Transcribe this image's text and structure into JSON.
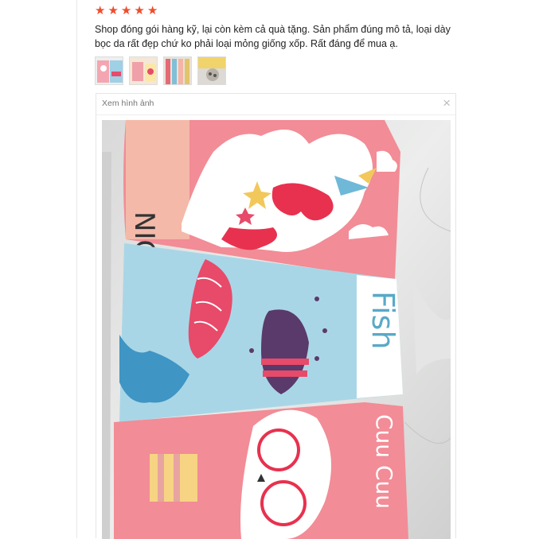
{
  "review": {
    "rating": 5,
    "stars": [
      "★",
      "★",
      "★",
      "★",
      "★"
    ],
    "comment": "Shop đóng gói hàng kỹ, lại còn kèm cả quà tặng. Sản phẩm đúng mô tả, loại dày bọc da rất đẹp chứ ko phải loại mỏng giống xốp. Rất đáng để mua ạ.",
    "accent_color": "#ee4d2d"
  },
  "thumbnails_count": 4,
  "viewer": {
    "title": "Xem hình ảnh",
    "close_icon": "×"
  },
  "photo": {
    "panel_1_text": "NICORN",
    "panel_2_text": "Fish",
    "panel_3_text": "Cuu Cuu"
  }
}
